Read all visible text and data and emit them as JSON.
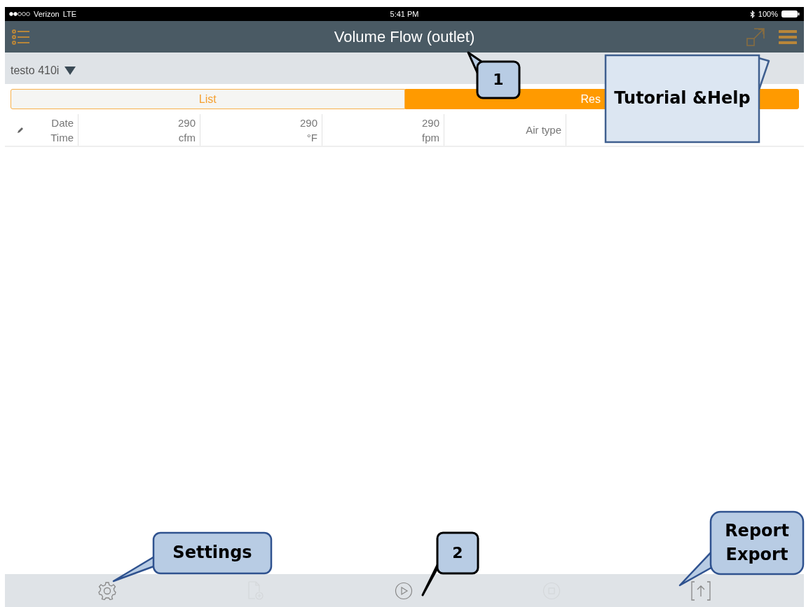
{
  "status_bar": {
    "carrier": "Verizon",
    "network": "LTE",
    "time": "5:41 PM",
    "battery": "100%"
  },
  "header": {
    "title": "Volume Flow (outlet)"
  },
  "device": {
    "name": "testo 410i"
  },
  "tabs": [
    {
      "label": "List",
      "selected": false
    },
    {
      "label": "Res",
      "selected": true
    }
  ],
  "table": {
    "columns": [
      {
        "line1": "Date",
        "line2": "Time"
      },
      {
        "line1": "290",
        "line2": "cfm"
      },
      {
        "line1": "290",
        "line2": "°F"
      },
      {
        "line1": "290",
        "line2": "fpm"
      },
      {
        "line1": "Air type"
      }
    ]
  },
  "toolbar": [
    {
      "kind": "settings",
      "disabled": false
    },
    {
      "kind": "new-file",
      "disabled": true
    },
    {
      "kind": "play",
      "disabled": false
    },
    {
      "kind": "stop",
      "disabled": true
    },
    {
      "kind": "export",
      "disabled": false
    }
  ],
  "callouts": [
    {
      "text": "1"
    },
    {
      "text": "Tutorial &Help"
    },
    {
      "text": "Settings"
    },
    {
      "text": "2"
    },
    {
      "text": "Report Export"
    }
  ]
}
